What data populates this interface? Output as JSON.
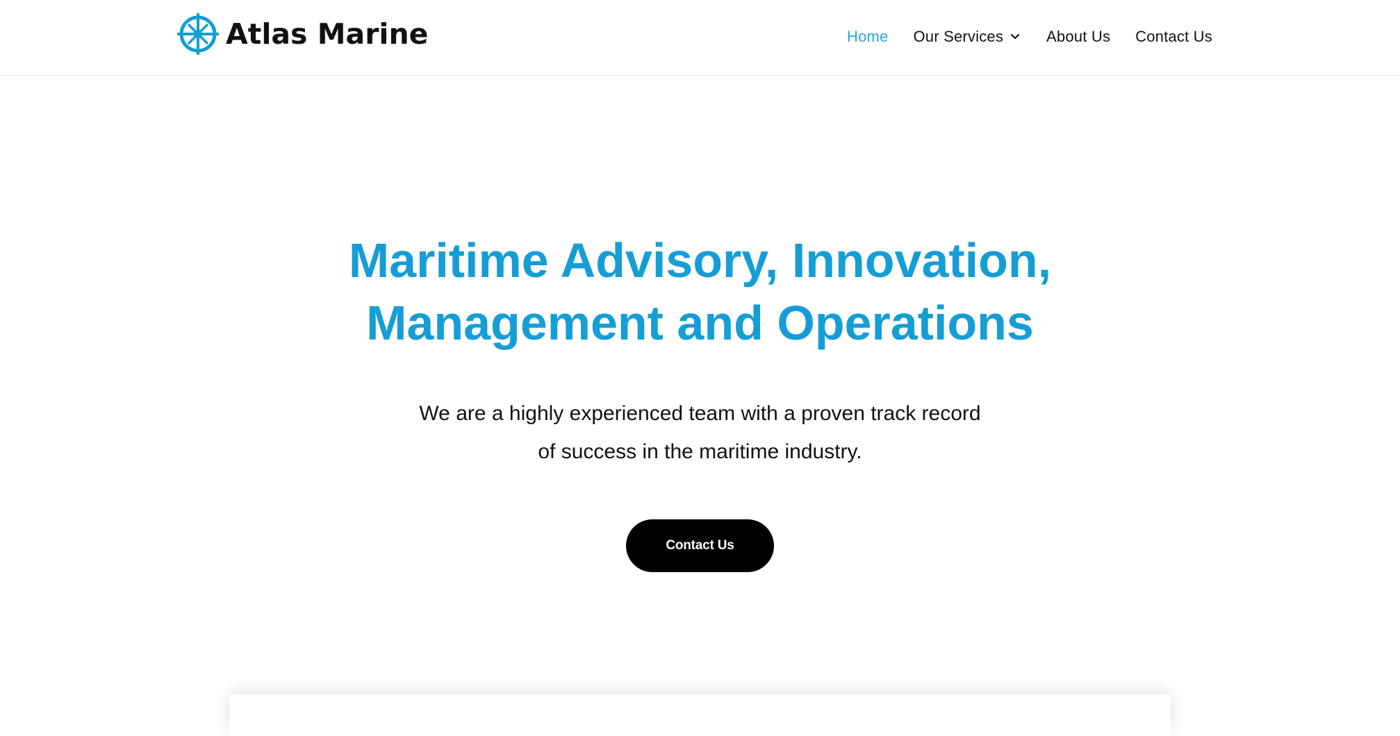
{
  "brand": {
    "name": "Atlas Marine",
    "icon": "compass-icon",
    "accent_color": "#159dd6"
  },
  "nav": {
    "items": [
      {
        "label": "Home",
        "active": true
      },
      {
        "label": "Our Services",
        "has_dropdown": true,
        "icon": "chevron-down-icon"
      },
      {
        "label": "About Us"
      },
      {
        "label": "Contact Us"
      }
    ]
  },
  "hero": {
    "title_line1": "Maritime Advisory, Innovation,",
    "title_line2": "Management and Operations",
    "subtitle_line1": "We are a highly experienced team with a proven track record",
    "subtitle_line2": "of success in the maritime industry.",
    "cta_label": "Contact Us"
  }
}
